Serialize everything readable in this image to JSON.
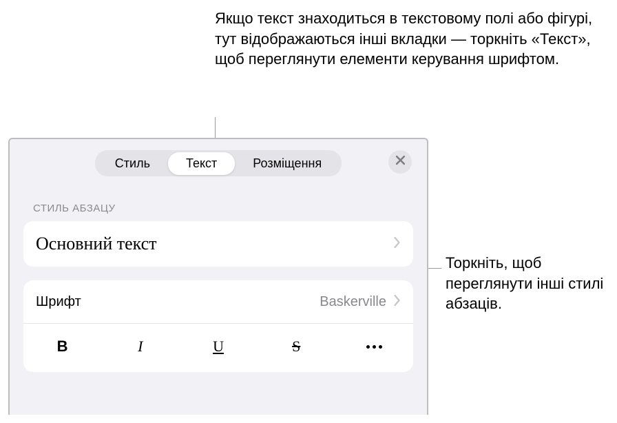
{
  "callouts": {
    "top": "Якщо текст знаходиться в текстовому полі або фігурі, тут відображаються інші вкладки — торкніть «Текст», щоб переглянути елементи керування шрифтом.",
    "right": "Торкніть, щоб переглянути інші стилі абзаців."
  },
  "tabs": {
    "style": "Стиль",
    "text": "Текст",
    "arrange": "Розміщення"
  },
  "section": {
    "paragraph_style_header": "СТИЛЬ АБЗАЦУ",
    "paragraph_style_value": "Основний текст"
  },
  "font": {
    "label": "Шрифт",
    "value": "Baskerville"
  },
  "format": {
    "bold": "B",
    "italic": "I",
    "underline": "U",
    "strike": "S"
  }
}
